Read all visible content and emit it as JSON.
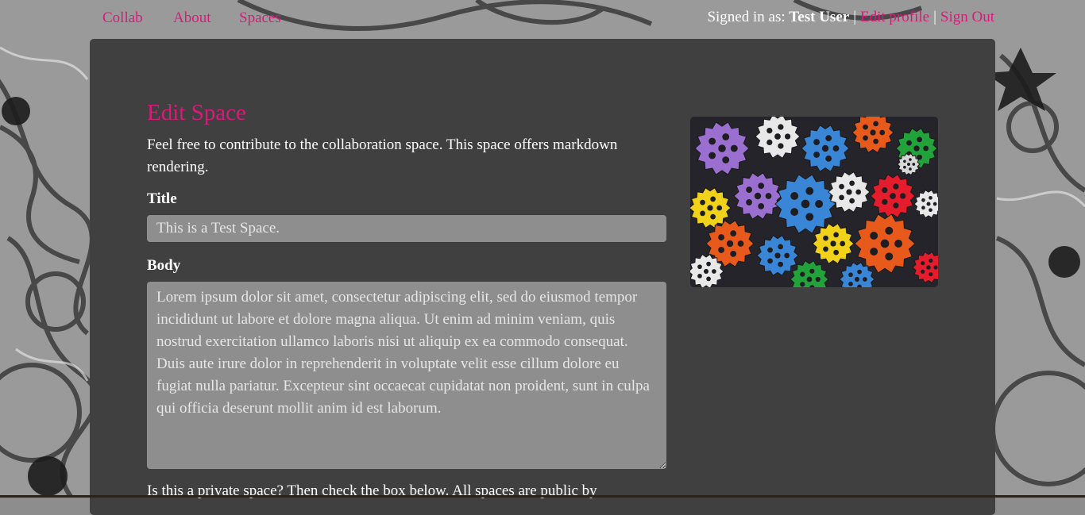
{
  "nav": {
    "links": [
      "Collab",
      "About",
      "Spaces"
    ]
  },
  "account": {
    "signed_in_label": "Signed in as:",
    "user_name": "Test User",
    "separator": "|",
    "edit_profile": "Edit profile",
    "sign_out": "Sign Out"
  },
  "form": {
    "heading": "Edit Space",
    "intro": "Feel free to contribute to the collaboration space. This space offers markdown rendering.",
    "title_label": "Title",
    "title_value": "This is a Test Space.",
    "body_label": "Body",
    "body_value": "Lorem ipsum dolor sit amet, consectetur adipiscing elit, sed do eiusmod tempor incididunt ut labore et dolore magna aliqua. Ut enim ad minim veniam, quis nostrud exercitation ullamco laboris nisi ut aliquip ex ea commodo consequat. Duis aute irure dolor in reprehenderit in voluptate velit esse cillum dolore eu fugiat nulla pariatur. Excepteur sint occaecat cupidatat non proident, sunt in culpa qui officia deserunt mollit anim id est laborum.",
    "private_note": "Is this a private space? Then check the box below. All spaces are public by"
  },
  "colors": {
    "accent": "#d81b7a",
    "panel": "#404040",
    "input_bg": "#8e8e8e"
  },
  "image": {
    "icon": "colorful-gears-image"
  }
}
